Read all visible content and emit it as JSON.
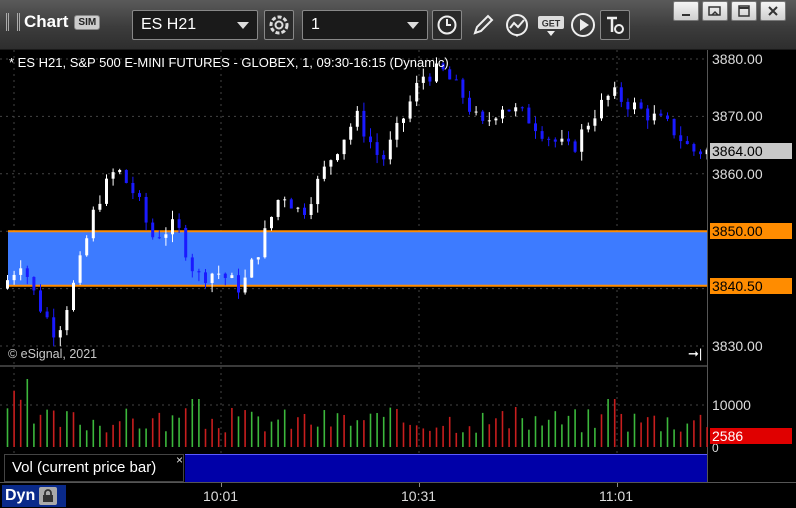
{
  "app": {
    "title": "Chart",
    "sim_badge": "SIM"
  },
  "toolbar": {
    "symbol_value": "ES H21",
    "interval_value": "1",
    "icons": [
      "link-gear-icon",
      "clock-icon",
      "pencil-icon",
      "study-icon",
      "get-icon",
      "play-icon",
      "text-icon"
    ],
    "window_buttons": [
      "minimize-icon",
      "restore-icon",
      "maximize-icon",
      "close-icon"
    ]
  },
  "chart": {
    "header": "* ES H21, S&P 500 E-MINI FUTURES - GLOBEX, 1, 09:30-16:15 (Dynamic)",
    "copyright": "© eSignal, 2021",
    "price_axis_labels": [
      "3880.00",
      "3870.00",
      "3860.00",
      "3830.00"
    ],
    "last_price": "3864.00",
    "zone_high": "3850.00",
    "zone_low": "3840.50",
    "zone_color": "#3d7bff",
    "zone_line_color": "#ff8c00"
  },
  "volume": {
    "study_label": "Vol (current price bar)",
    "close_label": "×",
    "axis_label": "10000",
    "zero_label": "0",
    "last_volume": "2586"
  },
  "time_axis": {
    "mode_label": "Dyn",
    "labels": [
      "10:01",
      "10:31",
      "11:01"
    ]
  },
  "colors": {
    "up_candle": "#ffffff",
    "down_candle": "#1a1aff",
    "vol_up": "#3cb83c",
    "vol_down": "#c81e1e"
  }
}
